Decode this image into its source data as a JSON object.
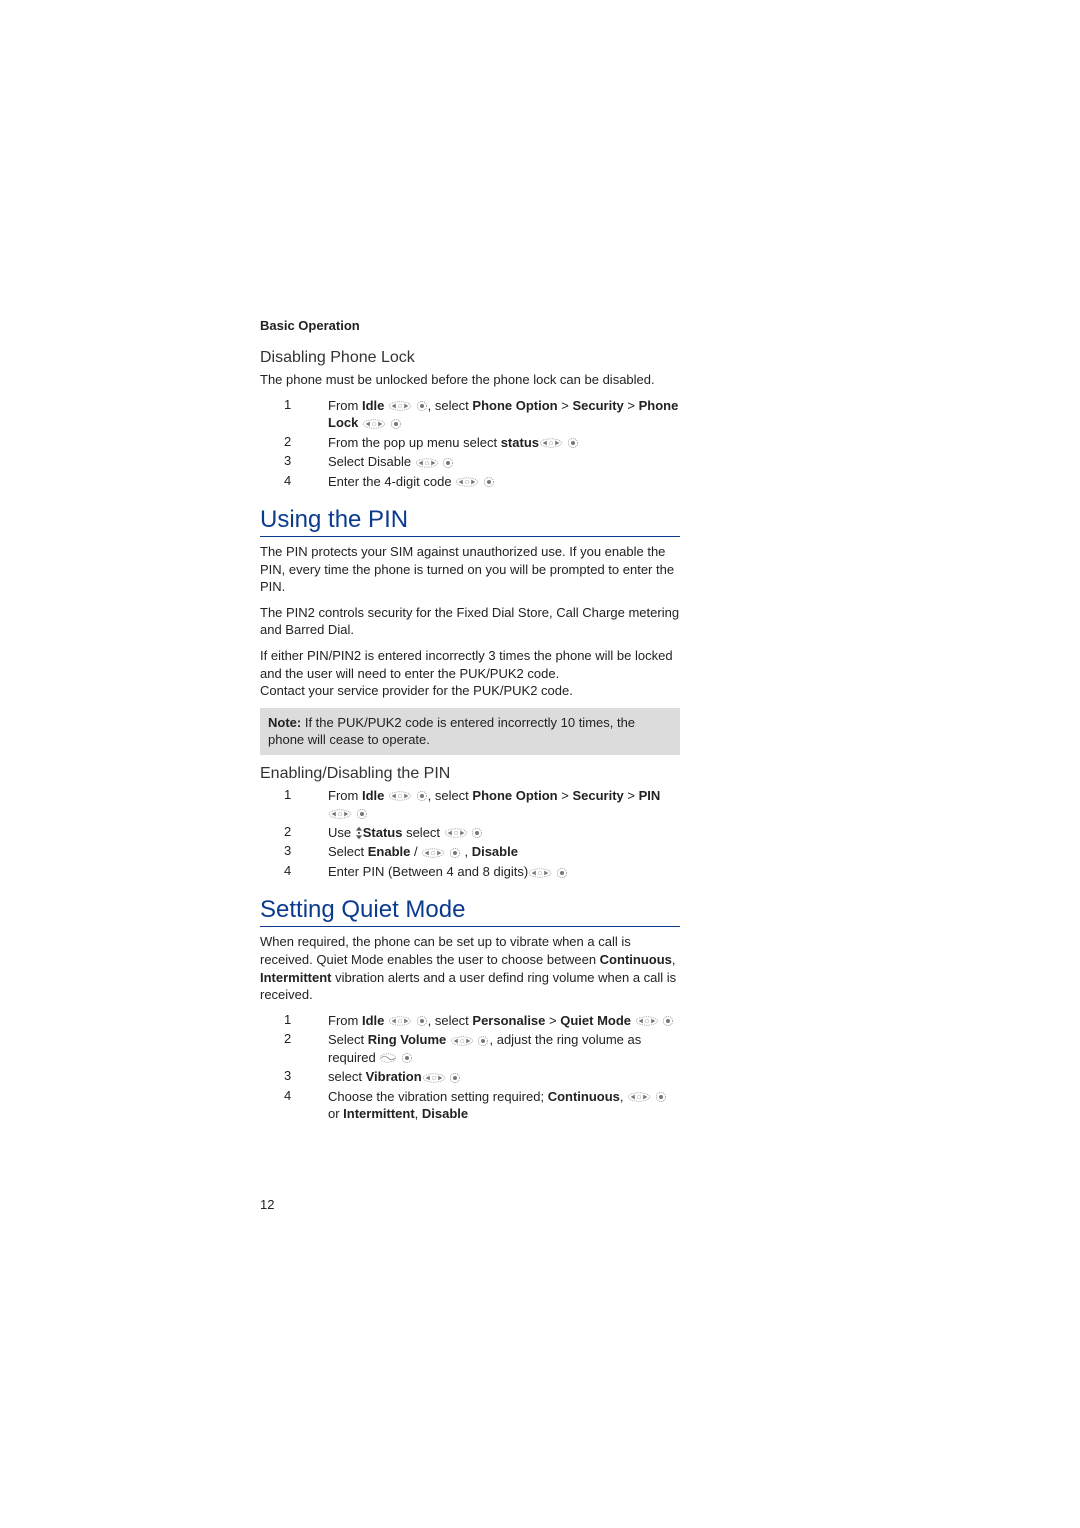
{
  "section": "Basic Operation",
  "disabling": {
    "title": "Disabling Phone Lock",
    "intro": "The phone must be unlocked before the phone lock can be disabled.",
    "steps": [
      {
        "n": "1",
        "pre": "From ",
        "b1": "Idle",
        "mid1": " ",
        "nav": true,
        "dot": true,
        "mid2": ", select ",
        "b2": "Phone Option",
        "mid3": " > ",
        "b3": "Security",
        "mid4": " > ",
        "b4": "Phone Lock",
        "tail": " ",
        "nav2": true,
        "dot2": true
      },
      {
        "n": "2",
        "pre": "From the pop up menu select ",
        "b1": "status",
        "tail": " ",
        "nav": true,
        "dot": true
      },
      {
        "n": "3",
        "pre": "Select Disable ",
        "nav": true,
        "dot": true
      },
      {
        "n": "4",
        "pre": "Enter the 4-digit code ",
        "nav": true,
        "dot": true
      }
    ]
  },
  "pin": {
    "title": "Using the PIN",
    "p1": "The PIN protects your SIM against unauthorized use. If you enable the PIN, every time the phone is turned on you will be prompted to enter the PIN.",
    "p2": "The PIN2 controls security for the Fixed Dial Store, Call Charge metering and Barred Dial.",
    "p3": "If either PIN/PIN2 is entered incorrectly 3 times the phone will be locked and the user will need to enter the PUK/PUK2 code.",
    "p4": "Contact your service provider for the PUK/PUK2 code.",
    "note_bold": "Note:",
    "note_text": " If the PUK/PUK2 code is entered incorrectly 10 times, the phone will cease to operate."
  },
  "enable_pin": {
    "title": "Enabling/Disabling the PIN",
    "steps": [
      {
        "n": "1",
        "pre": "From ",
        "b1": "Idle",
        "mid1": " ",
        "nav": true,
        "dot": true,
        "mid2": ", select ",
        "b2": "Phone Option",
        "mid3": " > ",
        "b3": "Security",
        "mid4": " > ",
        "b4": "PIN",
        "tail": " ",
        "nav2": true,
        "dot2": true
      },
      {
        "n": "2",
        "pre": "Use ",
        "updown": true,
        "mid1": " select  ",
        "b1": "Status",
        "tail": " ",
        "nav": true,
        "dot": true
      },
      {
        "n": "3",
        "pre": "Select ",
        "b1": "Enable",
        "mid1": " / ",
        "b2": "Disable",
        "mid2": " ,  ",
        "nav": true,
        "dot": true
      },
      {
        "n": "4",
        "pre": "Enter PIN (Between 4 and 8 digits)",
        "nav": true,
        "dot": true
      }
    ]
  },
  "quiet": {
    "title": "Setting Quiet Mode",
    "intro_pre": "When required, the phone can be set up to vibrate when a call is received. Quiet Mode enables the user to choose between ",
    "intro_b1": "Continuous",
    "intro_mid": ", ",
    "intro_b2": "Intermittent",
    "intro_post": " vibration alerts and a user defind ring volume when a call is received.",
    "steps": [
      {
        "n": "1",
        "pre": "From ",
        "b1": "Idle",
        "mid1": " ",
        "nav": true,
        "dot": true,
        "mid2": ", select ",
        "b2": "Personalise",
        "mid3": " > ",
        "b3": "Quiet Mode",
        "tail": " ",
        "nav2": true,
        "dot2": true
      },
      {
        "n": "2",
        "pre": "Select ",
        "b1": "Ring Volume",
        "mid1": " ",
        "nav": true,
        "dot": true,
        "mid2": ", adjust the ring volume as required ",
        "scroll": true,
        "dot2": true
      },
      {
        "n": "3",
        "pre": " select ",
        "b1": "Vibration",
        "tail": " ",
        "nav": true,
        "dot": true
      },
      {
        "n": "4",
        "pre": "Choose the vibration setting required; ",
        "b1": "Continuous",
        "mid1": ", ",
        "b2": "Intermittent",
        "mid2": " or ",
        "b3": "Disable",
        "mid3": ",  ",
        "nav": true,
        "dot": true
      }
    ]
  },
  "page_number": "12"
}
